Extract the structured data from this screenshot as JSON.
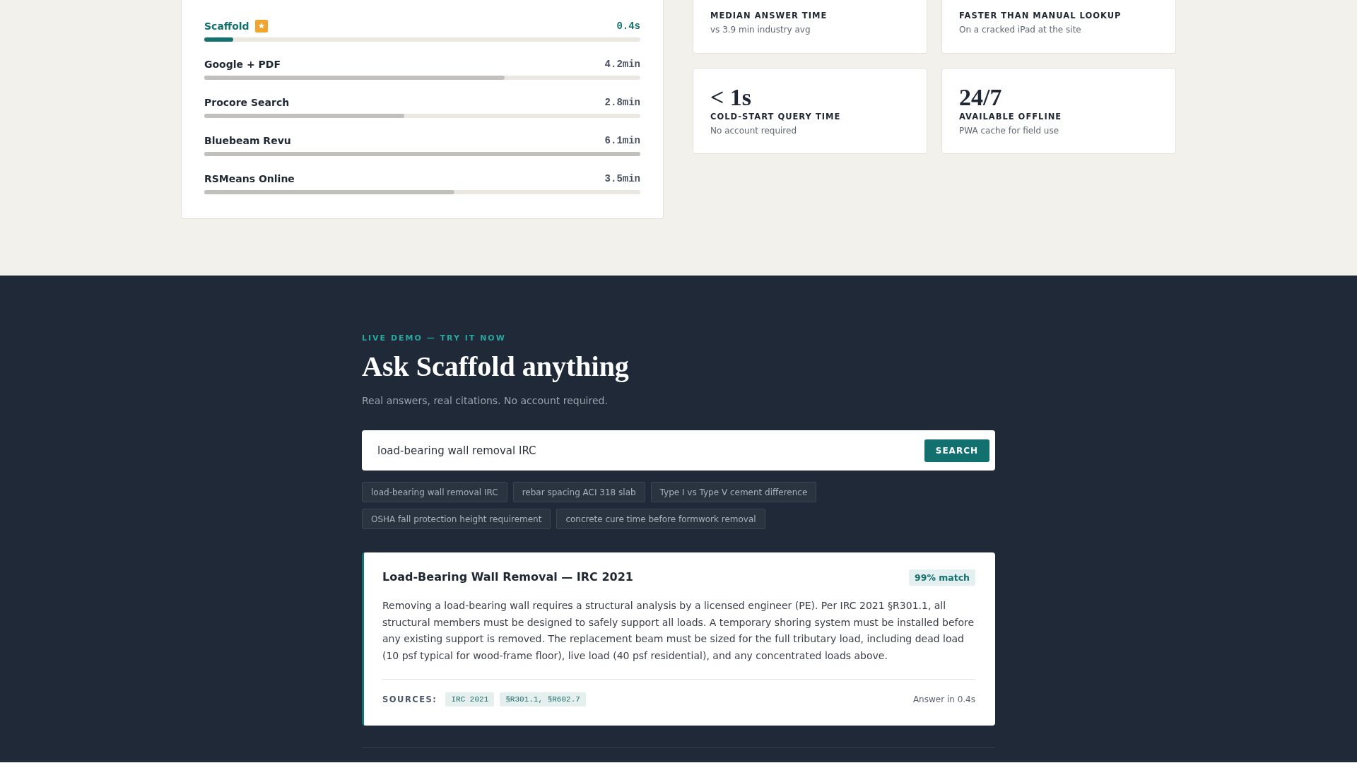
{
  "comparison": {
    "rows": [
      {
        "name": "Scaffold",
        "time": "0.4s",
        "level": 0.066,
        "featured": true
      },
      {
        "name": "Google + PDF",
        "time": "4.2min",
        "level": 0.689,
        "featured": false
      },
      {
        "name": "Procore Search",
        "time": "2.8min",
        "level": 0.459,
        "featured": false
      },
      {
        "name": "Bluebeam Revu",
        "time": "6.1min",
        "level": 1,
        "featured": false
      },
      {
        "name": "RSMeans Online",
        "time": "3.5min",
        "level": 0.574,
        "featured": false
      }
    ]
  },
  "stats": [
    {
      "label": "MEDIAN ANSWER TIME",
      "note": "vs 3.9 min industry avg"
    },
    {
      "label": "FASTER THAN MANUAL LOOKUP",
      "note": "On a cracked iPad at the site"
    },
    {
      "value": "< 1s",
      "label": "COLD-START QUERY TIME",
      "note": "No account required"
    },
    {
      "value": "24/7",
      "label": "AVAILABLE OFFLINE",
      "note": "PWA cache for field use"
    }
  ],
  "demo": {
    "eyebrow": "LIVE DEMO — TRY IT NOW",
    "title": "Ask Scaffold anything",
    "subtitle": "Real answers, real citations. No account required.",
    "search": {
      "value": "load-bearing wall removal IRC",
      "button": "SEARCH"
    },
    "suggestions": [
      "load-bearing wall removal IRC",
      "rebar spacing ACI 318 slab",
      "Type I vs Type V cement difference",
      "OSHA fall protection height requirement",
      "concrete cure time before formwork removal"
    ],
    "answer": {
      "title": "Load-Bearing Wall Removal — IRC 2021",
      "match": "99% match",
      "body": "Removing a load-bearing wall requires a structural analysis by a licensed engineer (PE). Per IRC 2021 §R301.1, all structural members must be designed to safely support all loads. A temporary shoring system must be installed before any existing support is removed. The replacement beam must be sized for the full tributary load, including dead load (10 psf typical for wood-frame floor), live load (40 psf residential), and any concentrated loads above.",
      "sources_label": "SOURCES:",
      "sources": [
        "IRC 2021",
        "§R301.1, §R602.7"
      ],
      "timing": "Answer in 0.4s"
    }
  }
}
